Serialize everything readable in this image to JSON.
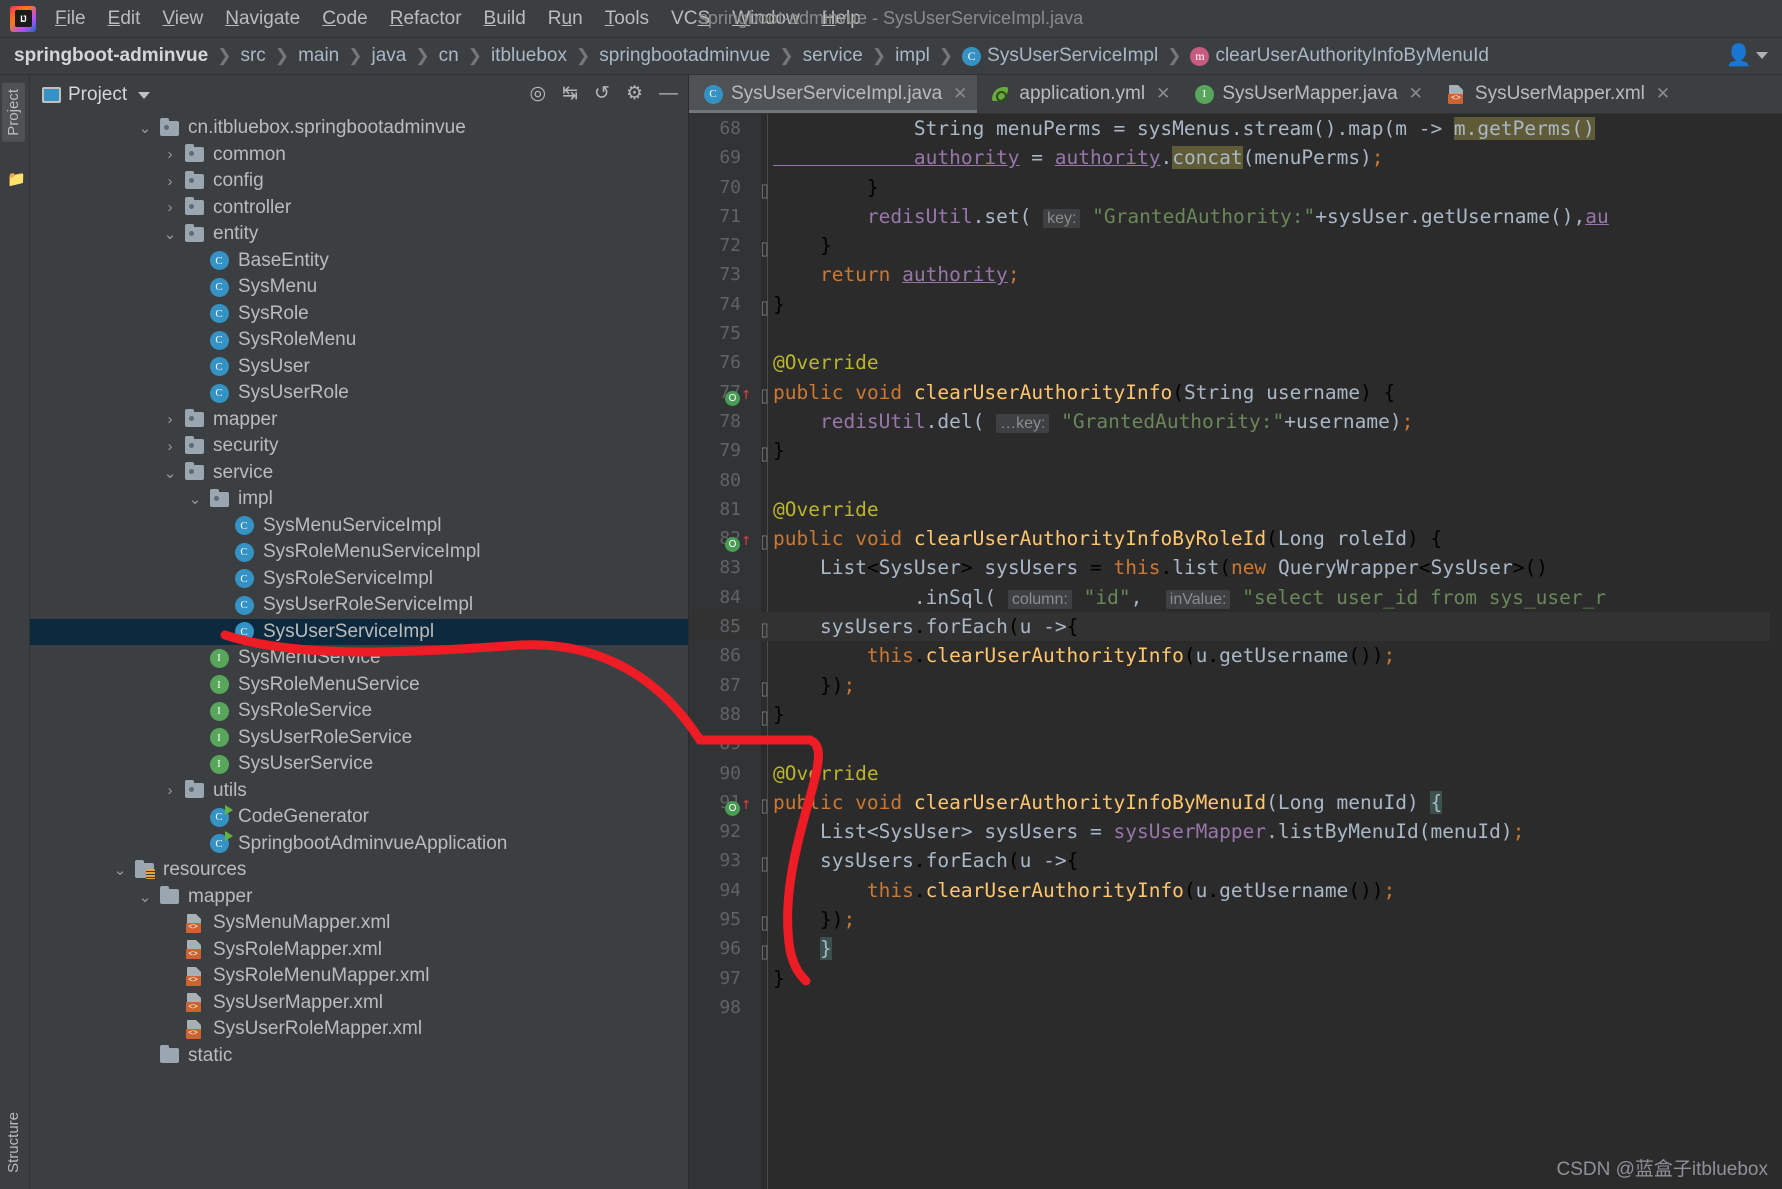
{
  "window": {
    "title": "springboot-adminvue - SysUserServiceImpl.java",
    "logo_label": "IJ"
  },
  "menubar": {
    "items": [
      {
        "label": "File"
      },
      {
        "label": "Edit"
      },
      {
        "label": "View"
      },
      {
        "label": "Navigate"
      },
      {
        "label": "Code"
      },
      {
        "label": "Refactor"
      },
      {
        "label": "Build"
      },
      {
        "label": "Run"
      },
      {
        "label": "Tools"
      },
      {
        "label": "VCS"
      },
      {
        "label": "Window"
      },
      {
        "label": "Help"
      }
    ]
  },
  "breadcrumb": {
    "items": [
      {
        "label": "springboot-adminvue",
        "icon": "",
        "bold": true
      },
      {
        "label": "src",
        "icon": ""
      },
      {
        "label": "main",
        "icon": ""
      },
      {
        "label": "java",
        "icon": ""
      },
      {
        "label": "cn",
        "icon": ""
      },
      {
        "label": "itbluebox",
        "icon": ""
      },
      {
        "label": "springbootadminvue",
        "icon": ""
      },
      {
        "label": "service",
        "icon": ""
      },
      {
        "label": "impl",
        "icon": ""
      },
      {
        "label": "SysUserServiceImpl",
        "icon": "class-icon"
      },
      {
        "label": "clearUserAuthorityInfoByMenuId",
        "icon": "method-icon"
      }
    ],
    "separator": "❯"
  },
  "toolwindow_strips": {
    "left_top": "Project",
    "left_bottom": "Structure"
  },
  "project_panel": {
    "title": "Project",
    "actions": [
      "target-icon",
      "collapse-icon",
      "expand-icon",
      "gear-icon",
      "minimize-icon"
    ],
    "tree": [
      {
        "label": "cn.itbluebox.springbootadminvue",
        "indent": 4,
        "arrow": "down",
        "icon": "package-folder",
        "selected": false
      },
      {
        "label": "common",
        "indent": 5,
        "arrow": "right",
        "icon": "package-folder",
        "selected": false
      },
      {
        "label": "config",
        "indent": 5,
        "arrow": "right",
        "icon": "package-folder",
        "selected": false
      },
      {
        "label": "controller",
        "indent": 5,
        "arrow": "right",
        "icon": "package-folder",
        "selected": false
      },
      {
        "label": "entity",
        "indent": 5,
        "arrow": "down",
        "icon": "package-folder",
        "selected": false
      },
      {
        "label": "BaseEntity",
        "indent": 6,
        "arrow": "none",
        "icon": "class-icon",
        "selected": false
      },
      {
        "label": "SysMenu",
        "indent": 6,
        "arrow": "none",
        "icon": "class-icon",
        "selected": false
      },
      {
        "label": "SysRole",
        "indent": 6,
        "arrow": "none",
        "icon": "class-icon",
        "selected": false
      },
      {
        "label": "SysRoleMenu",
        "indent": 6,
        "arrow": "none",
        "icon": "class-icon",
        "selected": false
      },
      {
        "label": "SysUser",
        "indent": 6,
        "arrow": "none",
        "icon": "class-icon",
        "selected": false
      },
      {
        "label": "SysUserRole",
        "indent": 6,
        "arrow": "none",
        "icon": "class-icon",
        "selected": false
      },
      {
        "label": "mapper",
        "indent": 5,
        "arrow": "right",
        "icon": "package-folder",
        "selected": false
      },
      {
        "label": "security",
        "indent": 5,
        "arrow": "right",
        "icon": "package-folder",
        "selected": false
      },
      {
        "label": "service",
        "indent": 5,
        "arrow": "down",
        "icon": "package-folder",
        "selected": false
      },
      {
        "label": "impl",
        "indent": 6,
        "arrow": "down",
        "icon": "package-folder",
        "selected": false
      },
      {
        "label": "SysMenuServiceImpl",
        "indent": 7,
        "arrow": "none",
        "icon": "class-icon",
        "selected": false
      },
      {
        "label": "SysRoleMenuServiceImpl",
        "indent": 7,
        "arrow": "none",
        "icon": "class-icon",
        "selected": false
      },
      {
        "label": "SysRoleServiceImpl",
        "indent": 7,
        "arrow": "none",
        "icon": "class-icon",
        "selected": false
      },
      {
        "label": "SysUserRoleServiceImpl",
        "indent": 7,
        "arrow": "none",
        "icon": "class-icon",
        "selected": false
      },
      {
        "label": "SysUserServiceImpl",
        "indent": 7,
        "arrow": "none",
        "icon": "class-icon",
        "selected": true
      },
      {
        "label": "SysMenuService",
        "indent": 6,
        "arrow": "none",
        "icon": "interface-icon",
        "selected": false
      },
      {
        "label": "SysRoleMenuService",
        "indent": 6,
        "arrow": "none",
        "icon": "interface-icon",
        "selected": false
      },
      {
        "label": "SysRoleService",
        "indent": 6,
        "arrow": "none",
        "icon": "interface-icon",
        "selected": false
      },
      {
        "label": "SysUserRoleService",
        "indent": 6,
        "arrow": "none",
        "icon": "interface-icon",
        "selected": false
      },
      {
        "label": "SysUserService",
        "indent": 6,
        "arrow": "none",
        "icon": "interface-icon",
        "selected": false
      },
      {
        "label": "utils",
        "indent": 5,
        "arrow": "right",
        "icon": "package-folder",
        "selected": false
      },
      {
        "label": "CodeGenerator",
        "indent": 6,
        "arrow": "none",
        "icon": "runnable-class-icon",
        "selected": false
      },
      {
        "label": "SpringbootAdminvueApplication",
        "indent": 6,
        "arrow": "none",
        "icon": "spring-boot-app-icon",
        "selected": false
      },
      {
        "label": "resources",
        "indent": 3,
        "arrow": "down",
        "icon": "resources-folder",
        "selected": false
      },
      {
        "label": "mapper",
        "indent": 4,
        "arrow": "down",
        "icon": "plain-folder",
        "selected": false
      },
      {
        "label": "SysMenuMapper.xml",
        "indent": 5,
        "arrow": "none",
        "icon": "xml-icon",
        "selected": false
      },
      {
        "label": "SysRoleMapper.xml",
        "indent": 5,
        "arrow": "none",
        "icon": "xml-icon",
        "selected": false
      },
      {
        "label": "SysRoleMenuMapper.xml",
        "indent": 5,
        "arrow": "none",
        "icon": "xml-icon",
        "selected": false
      },
      {
        "label": "SysUserMapper.xml",
        "indent": 5,
        "arrow": "none",
        "icon": "xml-icon",
        "selected": false
      },
      {
        "label": "SysUserRoleMapper.xml",
        "indent": 5,
        "arrow": "none",
        "icon": "xml-icon",
        "selected": false
      },
      {
        "label": "static",
        "indent": 4,
        "arrow": "none",
        "icon": "plain-folder",
        "selected": false
      }
    ]
  },
  "editor_tabs": [
    {
      "label": "SysUserServiceImpl.java",
      "icon": "class-icon",
      "active": true,
      "close": "✕"
    },
    {
      "label": "application.yml",
      "icon": "yaml-icon",
      "active": false,
      "close": "✕"
    },
    {
      "label": "SysUserMapper.java",
      "icon": "interface-icon",
      "active": false,
      "close": "✕"
    },
    {
      "label": "SysUserMapper.xml",
      "icon": "xml-icon",
      "active": false,
      "close": "✕"
    }
  ],
  "code": {
    "first_line": 68,
    "lines": [
      {
        "n": 68,
        "text": "            String menuPerms = sysMenus.stream().map(m -> m.getPerms())"
      },
      {
        "n": 69,
        "text": "            authority = authority.concat(menuPerms);"
      },
      {
        "n": 70,
        "text": "        }"
      },
      {
        "n": 71,
        "text": "        redisUtil.set( key: \"GrantedAuthority:\"+sysUser.getUsername(),au"
      },
      {
        "n": 72,
        "text": "    }"
      },
      {
        "n": 73,
        "text": "    return authority;"
      },
      {
        "n": 74,
        "text": "}"
      },
      {
        "n": 75,
        "text": ""
      },
      {
        "n": 76,
        "text": "@Override"
      },
      {
        "n": 77,
        "text": "public void clearUserAuthorityInfo(String username) {"
      },
      {
        "n": 78,
        "text": "    redisUtil.del( …key: \"GrantedAuthority:\"+username);"
      },
      {
        "n": 79,
        "text": "}"
      },
      {
        "n": 80,
        "text": ""
      },
      {
        "n": 81,
        "text": "@Override"
      },
      {
        "n": 82,
        "text": "public void clearUserAuthorityInfoByRoleId(Long roleId) {"
      },
      {
        "n": 83,
        "text": "    List<SysUser> sysUsers = this.list(new QueryWrapper<SysUser>()"
      },
      {
        "n": 84,
        "text": "            .inSql( column: \"id\",  inValue: \"select user_id from sys_user_r"
      },
      {
        "n": 85,
        "text": "    sysUsers.forEach(u ->{"
      },
      {
        "n": 86,
        "text": "        this.clearUserAuthorityInfo(u.getUsername());"
      },
      {
        "n": 87,
        "text": "    });"
      },
      {
        "n": 88,
        "text": "}"
      },
      {
        "n": 89,
        "text": ""
      },
      {
        "n": 90,
        "text": "@Override"
      },
      {
        "n": 91,
        "text": "public void clearUserAuthorityInfoByMenuId(Long menuId) {"
      },
      {
        "n": 92,
        "text": "    List<SysUser> sysUsers = sysUserMapper.listByMenuId(menuId);"
      },
      {
        "n": 93,
        "text": "    sysUsers.forEach(u ->{"
      },
      {
        "n": 94,
        "text": "        this.clearUserAuthorityInfo(u.getUsername());"
      },
      {
        "n": 95,
        "text": "    });"
      },
      {
        "n": 96,
        "text": "}"
      },
      {
        "n": 97,
        "text": "}"
      },
      {
        "n": 98,
        "text": ""
      }
    ],
    "override_markers": [
      77,
      82,
      91
    ],
    "param_hints": [
      "key:",
      "…key:",
      "column:",
      "inValue:"
    ]
  },
  "watermark": "CSDN @蓝盒子itbluebox",
  "colors": {
    "background": "#2b2b2b",
    "panel": "#3c3f41",
    "selection": "#0d293e",
    "annotation": "#ee1c24",
    "keyword": "#cc7832",
    "string": "#6a8759",
    "method": "#ffc66d",
    "annotation_text": "#bbb529",
    "field": "#9876aa",
    "plain": "#a9b7c6"
  }
}
